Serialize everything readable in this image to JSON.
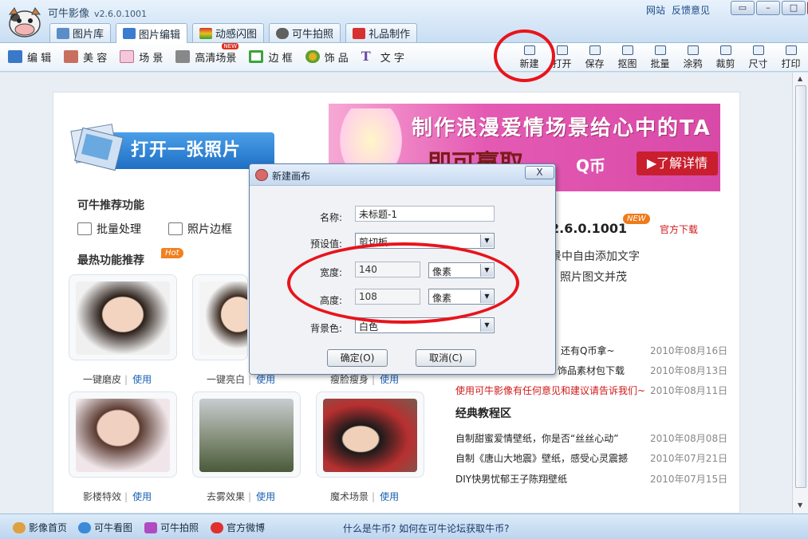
{
  "app": {
    "title": "可牛影像",
    "version": "v2.6.0.1001",
    "links": [
      "网站",
      "反馈意见"
    ],
    "window_buttons": [
      "▭",
      "–",
      "□",
      "✕"
    ]
  },
  "main_tabs": [
    {
      "label": "图片库",
      "color": "#5b8dc8"
    },
    {
      "label": "图片编辑",
      "color": "#3b7bd0"
    },
    {
      "label": "动感闪图",
      "color": "#d8a030"
    },
    {
      "label": "可牛拍照",
      "color": "#606060"
    },
    {
      "label": "礼品制作",
      "color": "#d83030"
    }
  ],
  "toolbar_left": [
    {
      "label": "编 辑",
      "color": "#3a78c8"
    },
    {
      "label": "美 容",
      "color": "#c87060"
    },
    {
      "label": "场 景",
      "color": "#e8a0c0"
    },
    {
      "label": "高清场景",
      "color": "#888888"
    },
    {
      "label": "边 框",
      "color": "#40a040"
    },
    {
      "label": "饰 品",
      "color": "#e0b020"
    },
    {
      "label": "文 字",
      "color": "#6a4aa8"
    }
  ],
  "hd_badge": "NEW",
  "toolbar_right": [
    "新建",
    "打开",
    "保存",
    "抠图",
    "批量",
    "涂鸦",
    "裁剪",
    "尺寸",
    "打印"
  ],
  "open_photo": "打开一张照片",
  "recommend": {
    "title": "可牛推荐功能",
    "items": [
      "批量处理",
      "照片边框"
    ]
  },
  "hot": {
    "title": "最热功能推荐",
    "badge": "Hot"
  },
  "thumbs": [
    {
      "caption": "一键磨皮",
      "use": "使用",
      "color": "#e8c8b0"
    },
    {
      "caption": "一键亮白",
      "use": "使用",
      "color": "#f0d0b8"
    },
    {
      "caption": "瘦脸瘦身",
      "use": "使用",
      "color": "#c8d8e8"
    },
    {
      "caption": "影楼特效",
      "use": "使用",
      "color": "#d8b8b8"
    },
    {
      "caption": "去雾效果",
      "use": "使用",
      "color": "#9aa890"
    },
    {
      "caption": "魔术场景",
      "use": "使用",
      "color": "#6a5a58"
    }
  ],
  "banner": {
    "headline": "制作浪漫爱情场景给心中的TA",
    "sub": "即可赢取",
    "sub_q": "Q币",
    "detail": "▶了解详情"
  },
  "version_info": {
    "text": "2.6.0.1001",
    "badge": "NEW",
    "download": "官方下载",
    "lines": [
      "景中自由添加文字",
      "照片图文并茂"
    ]
  },
  "news": [
    {
      "title": "还有Q币拿~",
      "date": "2010年08月16日"
    },
    {
      "title": "饰品素材包下载",
      "date": "2010年08月13日"
    },
    {
      "title": "使用可牛影像有任何意见和建议请告诉我们~",
      "date": "2010年08月11日"
    }
  ],
  "tutorials": {
    "title": "经典教程区",
    "items": [
      {
        "title": "自制甜蜜爱情壁纸，你是否“丝丝心动”",
        "date": "2010年08月08日"
      },
      {
        "title": "自制《唐山大地震》壁纸，感受心灵震撼",
        "date": "2010年07月21日"
      },
      {
        "title": "DIY快男忧郁王子陈翔壁纸",
        "date": "2010年07月15日"
      }
    ]
  },
  "statusbar": {
    "items": [
      "影像首页",
      "可牛看图",
      "可牛拍照",
      "官方微博"
    ],
    "help": "什么是牛币? 如何在可牛论坛获取牛币?"
  },
  "dialog": {
    "title": "新建画布",
    "close": "X",
    "name_label": "名称:",
    "name_value": "未标题-1",
    "preset_label": "预设值:",
    "preset_value": "剪切板",
    "width_label": "宽度:",
    "width_value": "140",
    "width_unit": "像素",
    "height_label": "高度:",
    "height_value": "108",
    "height_unit": "像素",
    "bg_label": "背景色:",
    "bg_value": "白色",
    "ok": "确定(O)",
    "cancel": "取消(C)"
  }
}
